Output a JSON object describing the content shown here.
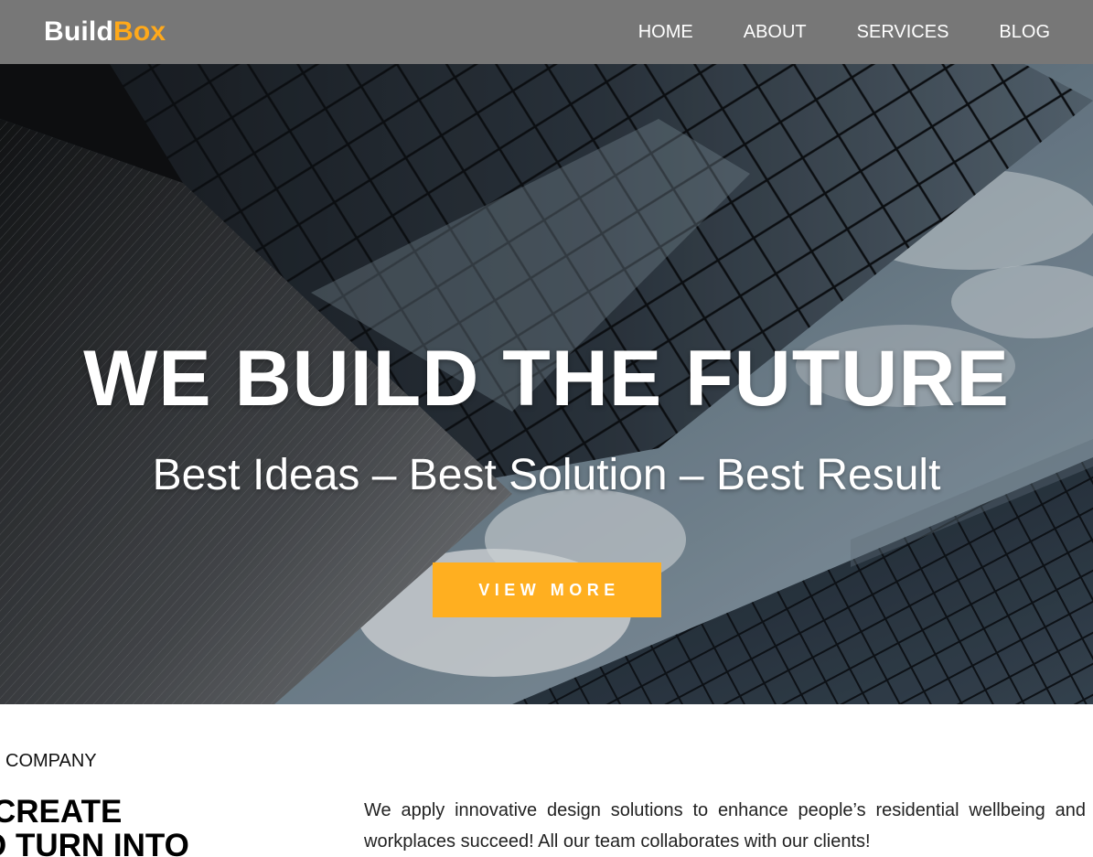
{
  "brand": {
    "part1": "Build",
    "part2": "Box",
    "accent_color": "#ffa91a"
  },
  "nav": {
    "items": [
      {
        "label": "HOME"
      },
      {
        "label": "ABOUT"
      },
      {
        "label": "SERVICES"
      },
      {
        "label": "BLOG"
      }
    ]
  },
  "hero": {
    "title": "WE BUILD THE FUTURE",
    "subtitle": "Best Ideas – Best Solution – Best Result",
    "button_label": "VIEW MORE",
    "button_color": "#ffaf20"
  },
  "about": {
    "eyebrow": "COMPANY",
    "heading_line1": "CREATE",
    "heading_line2": "O TURN INTO",
    "text": "We apply innovative design solutions to enhance people’s residential wellbeing and workplaces succeed! All our team collaborates with our clients!"
  }
}
